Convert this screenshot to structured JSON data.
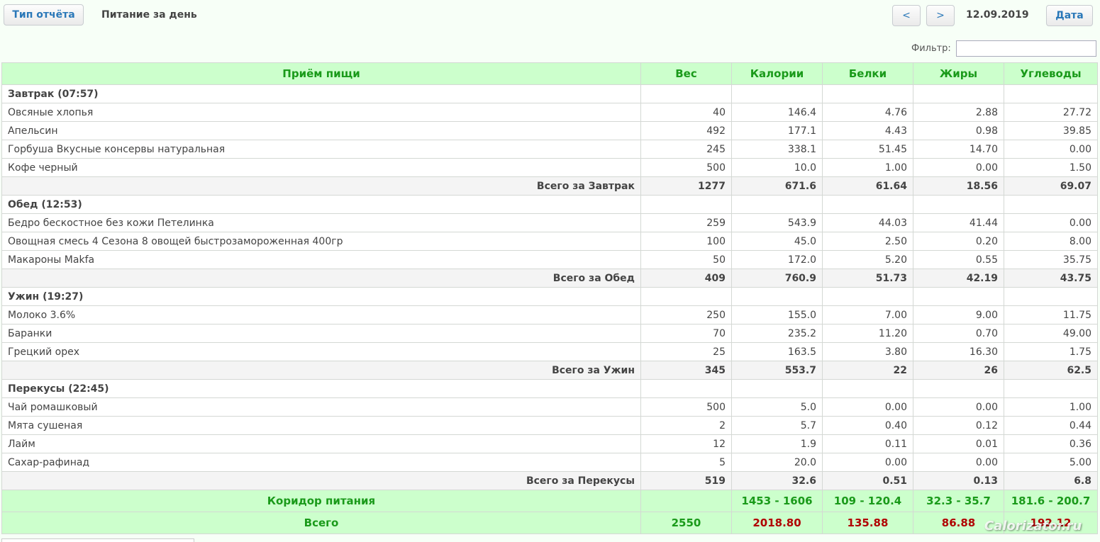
{
  "toolbar": {
    "report_type_label": "Тип отчёта",
    "title": "Питание за день",
    "prev_label": "<",
    "next_label": ">",
    "date": "12.09.2019",
    "date_button_label": "Дата"
  },
  "filter": {
    "label": "Фильтр:",
    "value": ""
  },
  "table": {
    "headers": [
      "Приём пищи",
      "Вес",
      "Калории",
      "Белки",
      "Жиры",
      "Углеводы"
    ],
    "meals": [
      {
        "name": "Завтрак (07:57)",
        "items": [
          [
            "Овсяные хлопья",
            "40",
            "146.4",
            "4.76",
            "2.88",
            "27.72"
          ],
          [
            "Апельсин",
            "492",
            "177.1",
            "4.43",
            "0.98",
            "39.85"
          ],
          [
            "Горбуша Вкусные консервы натуральная",
            "245",
            "338.1",
            "51.45",
            "14.70",
            "0.00"
          ],
          [
            "Кофе черный",
            "500",
            "10.0",
            "1.00",
            "0.00",
            "1.50"
          ]
        ],
        "total": [
          "Всего за Завтрак",
          "1277",
          "671.6",
          "61.64",
          "18.56",
          "69.07"
        ]
      },
      {
        "name": "Обед (12:53)",
        "items": [
          [
            "Бедро бескостное без кожи Петелинка",
            "259",
            "543.9",
            "44.03",
            "41.44",
            "0.00"
          ],
          [
            "Овощная смесь 4 Сезона 8 овощей быстрозамороженная 400гр",
            "100",
            "45.0",
            "2.50",
            "0.20",
            "8.00"
          ],
          [
            "Макароны Makfa",
            "50",
            "172.0",
            "5.20",
            "0.55",
            "35.75"
          ]
        ],
        "total": [
          "Всего за Обед",
          "409",
          "760.9",
          "51.73",
          "42.19",
          "43.75"
        ]
      },
      {
        "name": "Ужин (19:27)",
        "items": [
          [
            "Молоко 3.6%",
            "250",
            "155.0",
            "7.00",
            "9.00",
            "11.75"
          ],
          [
            "Баранки",
            "70",
            "235.2",
            "11.20",
            "0.70",
            "49.00"
          ],
          [
            "Грецкий орех",
            "25",
            "163.5",
            "3.80",
            "16.30",
            "1.75"
          ]
        ],
        "total": [
          "Всего за Ужин",
          "345",
          "553.7",
          "22",
          "26",
          "62.5"
        ]
      },
      {
        "name": "Перекусы (22:45)",
        "items": [
          [
            "Чай ромашковый",
            "500",
            "5.0",
            "0.00",
            "0.00",
            "1.00"
          ],
          [
            "Мята сушеная",
            "2",
            "5.7",
            "0.40",
            "0.12",
            "0.44"
          ],
          [
            "Лайм",
            "12",
            "1.9",
            "0.11",
            "0.01",
            "0.36"
          ],
          [
            "Сахар-рафинад",
            "5",
            "20.0",
            "0.00",
            "0.00",
            "5.00"
          ]
        ],
        "total": [
          "Всего за Перекусы",
          "519",
          "32.6",
          "0.51",
          "0.13",
          "6.8"
        ]
      }
    ],
    "corridor": [
      "Коридор питания",
      "",
      "1453 - 1606",
      "109 - 120.4",
      "32.3 - 35.7",
      "181.6 - 200.7"
    ],
    "grand_total": [
      "Всего",
      "2550",
      "2018.80",
      "135.88",
      "86.88",
      "192.12"
    ]
  },
  "watermark": "Calorizator.ru",
  "colors": {
    "header_bg": "#ccffcc",
    "header_text": "#1a9a1a",
    "over_limit": "#b00000",
    "button_text": "#2a78b8"
  }
}
